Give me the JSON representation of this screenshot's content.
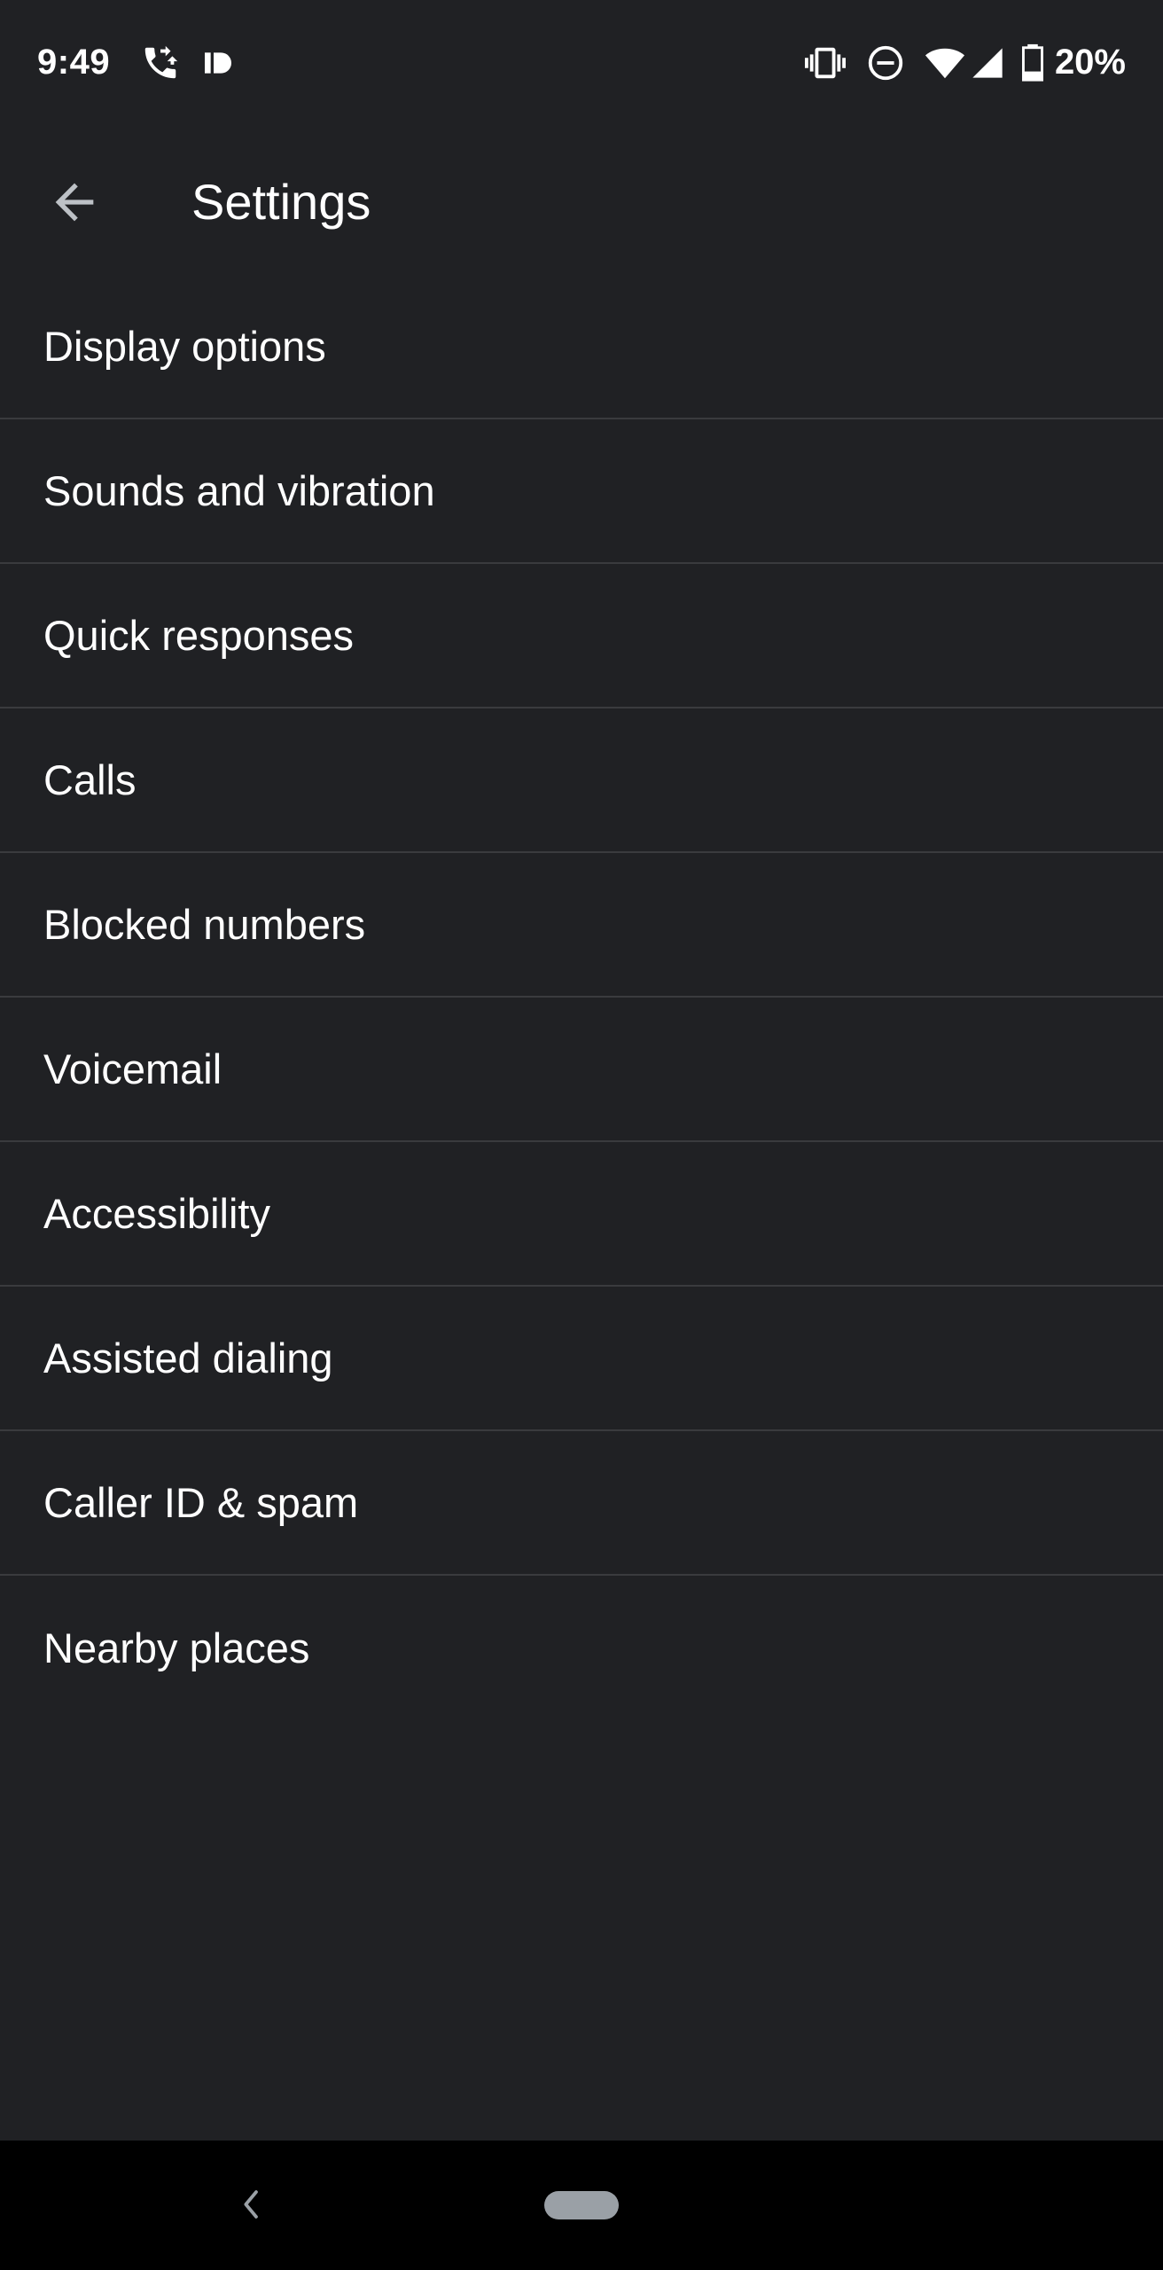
{
  "status_bar": {
    "time": "9:49",
    "battery_percent": "20%",
    "icons": [
      "call-forward-icon",
      "caller-id-icon",
      "vibrate-icon",
      "do-not-disturb-icon",
      "wifi-icon",
      "cell-signal-icon",
      "battery-icon"
    ]
  },
  "app_bar": {
    "title": "Settings",
    "back_icon": "back-arrow-icon"
  },
  "settings": {
    "items": [
      {
        "label": "Display options"
      },
      {
        "label": "Sounds and vibration"
      },
      {
        "label": "Quick responses"
      },
      {
        "label": "Calls"
      },
      {
        "label": "Blocked numbers"
      },
      {
        "label": "Voicemail"
      },
      {
        "label": "Accessibility"
      },
      {
        "label": "Assisted dialing"
      },
      {
        "label": "Caller ID & spam"
      },
      {
        "label": "Nearby places"
      }
    ]
  },
  "nav_bar": {
    "back_icon": "nav-back-icon",
    "home_icon": "home-pill-icon"
  },
  "colors": {
    "background": "#202124",
    "divider": "#3a3b3e",
    "text": "#ffffff",
    "nav_background": "#000000",
    "home_pill": "#9aa0a6"
  }
}
